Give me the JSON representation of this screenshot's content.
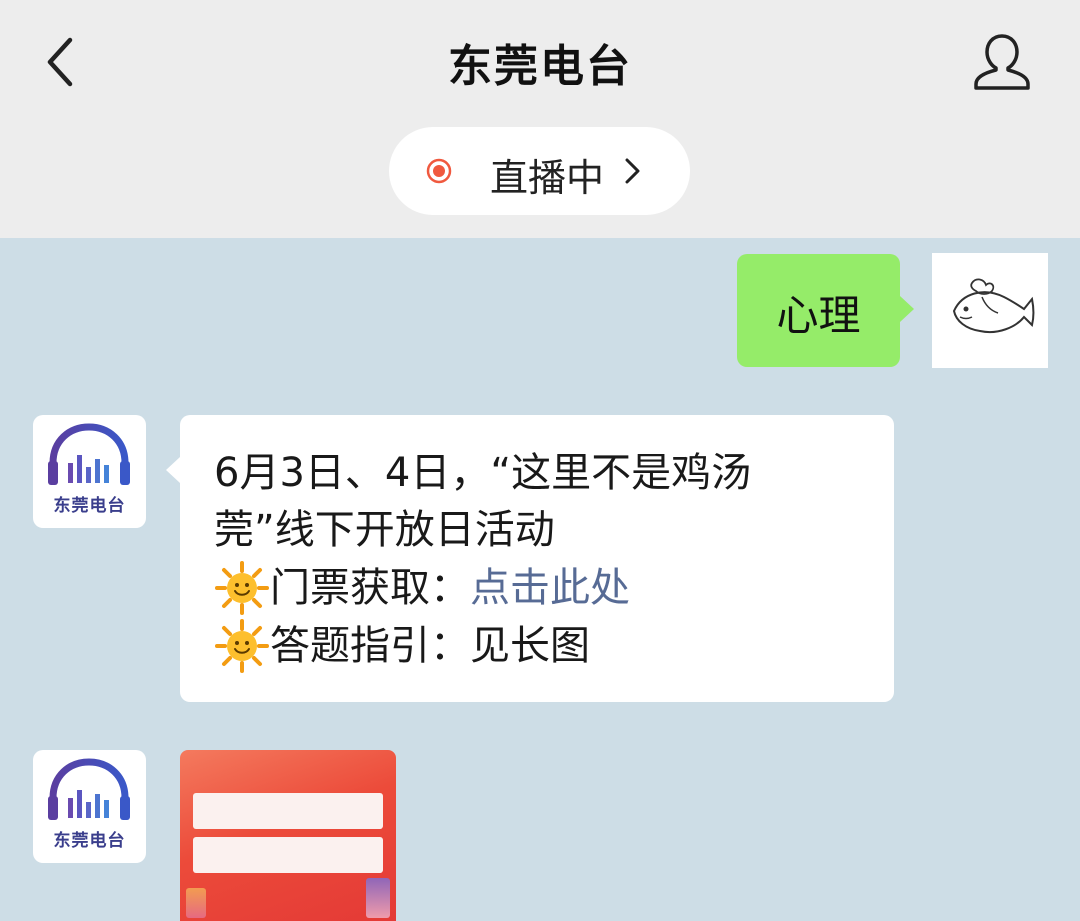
{
  "header": {
    "title": "东莞电台",
    "back_icon": "chevron-left-icon",
    "profile_icon": "person-icon",
    "live": {
      "label": "直播中",
      "icon": "live-dot-icon",
      "chevron": "chevron-right-icon",
      "dot_color": "#f0593f"
    }
  },
  "colors": {
    "header_bg": "#ededed",
    "chat_bg": "#cddde6",
    "my_bubble": "#95ec69",
    "link": "#576b95",
    "logo": "#3a3e8c"
  },
  "messages": [
    {
      "sender": "me",
      "type": "text",
      "text": "心理",
      "avatar_icon": "fish-avatar-icon"
    },
    {
      "sender": "radio",
      "type": "text",
      "avatar": {
        "logo_text": "东莞电台",
        "icon": "headphones-logo-icon"
      },
      "lines": [
        {
          "text": "6月3日、4日，“这里不是鸡汤"
        },
        {
          "text": "莞”线下开放日活动"
        },
        {
          "emoji": "sun-face-icon",
          "prefix": "门票获取：",
          "link": "点击此处"
        },
        {
          "emoji": "sun-face-icon",
          "prefix": "答题指引：",
          "suffix": "见长图"
        }
      ]
    },
    {
      "sender": "radio",
      "type": "image",
      "avatar": {
        "logo_text": "东莞电台",
        "icon": "headphones-logo-icon"
      },
      "image_icon": "poster-image-icon"
    }
  ]
}
